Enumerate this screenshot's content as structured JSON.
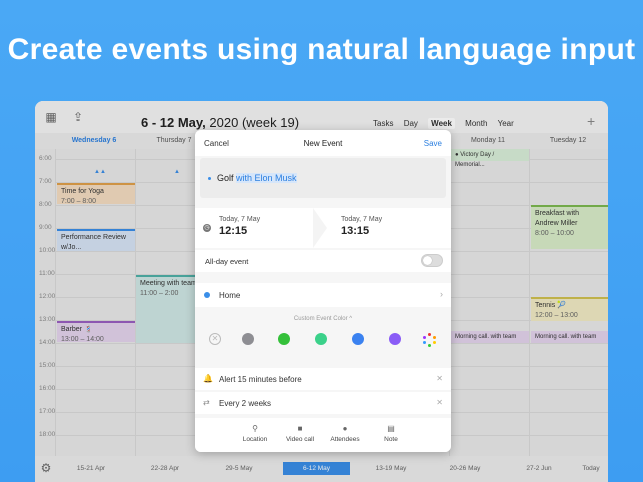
{
  "headline": "Create events using natural language input",
  "toolbar": {
    "title_range": "6 - 12 May,",
    "title_rest": "2020 (week 19)",
    "views": [
      "Tasks",
      "Day",
      "Week",
      "Month",
      "Year"
    ],
    "active_view": "Week",
    "add_label": "+"
  },
  "days": [
    {
      "label": "Wednesday 6"
    },
    {
      "label": "Thursday 7"
    },
    {
      "label": ""
    },
    {
      "label": ""
    },
    {
      "label": ""
    },
    {
      "label": "Monday 11"
    },
    {
      "label": "Tuesday 12"
    }
  ],
  "hours": [
    "6:00",
    "7:00",
    "8:00",
    "9:00",
    "10:00",
    "11:00",
    "12:00",
    "13:00",
    "14:00",
    "15:00",
    "16:00",
    "17:00",
    "18:00"
  ],
  "events": {
    "yoga": {
      "title": "Time for Yoga",
      "time": "7:00 – 8:00"
    },
    "performance": {
      "title": "Performance Review w/Jo..."
    },
    "barber": {
      "title": "Barber 💈",
      "time": "13:00 – 14:00"
    },
    "meeting": {
      "title": "Meeting with team 🚀",
      "time": "11:00 – 2:00"
    },
    "victory": {
      "title": "● Victory Day / Memorial..."
    },
    "breakfast": {
      "title": "Breakfast with Andrew Miller",
      "time": "8:00 – 10:00"
    },
    "tennis": {
      "title": "Tennis 🎾",
      "time": "12:00 – 13:00"
    },
    "morning1": {
      "title": "Morning call. with team"
    },
    "morning2": {
      "title": "Morning call. with team"
    }
  },
  "weeks": [
    "15-21 Apr",
    "22-28 Apr",
    "29-5 May",
    "6-12 May",
    "13-19 May",
    "20-26 May",
    "27-2 Jun"
  ],
  "active_week": "6-12 May",
  "today_label": "Today",
  "modal": {
    "cancel": "Cancel",
    "title": "New Event",
    "save": "Save",
    "input_plain": "Golf ",
    "input_highlight": "with Elon Musk",
    "start_date": "Today, 7 May",
    "start_time": "12:15",
    "end_date": "Today, 7 May",
    "end_time": "13:15",
    "all_day_label": "All-day event",
    "calendar": "Home",
    "color_label": "Custom Event Color ^",
    "colors": [
      "#8e8e93",
      "#34c03a",
      "#3bd18a",
      "#3b82f0",
      "#8a5cf6"
    ],
    "alert": "Alert 15 minutes before",
    "repeat": "Every 2 weeks",
    "actions": [
      "Location",
      "Video call",
      "Attendees",
      "Note"
    ]
  }
}
